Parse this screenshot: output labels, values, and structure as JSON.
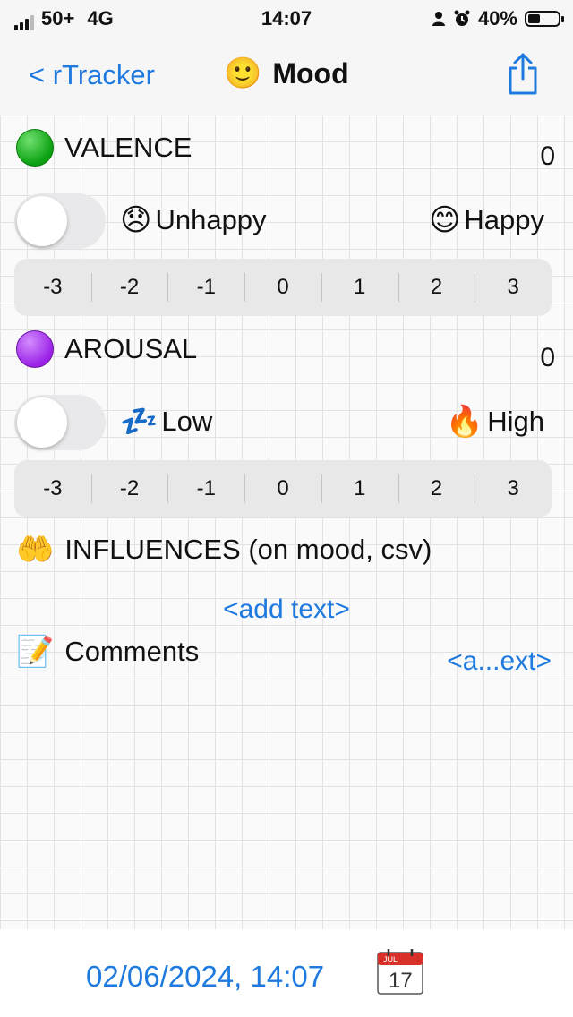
{
  "status_bar": {
    "carrier": "50+",
    "network": "4G",
    "time": "14:07",
    "battery": "40%",
    "battery_fraction": 0.4
  },
  "nav": {
    "back_label": "< rTracker",
    "title_emoji": "🙂",
    "title": "Mood"
  },
  "valence": {
    "label": "VALENCE",
    "value": "0",
    "left_emoji": "😞",
    "left_label": "Unhappy",
    "right_emoji": "😊",
    "right_label": "Happy",
    "scale": [
      "-3",
      "-2",
      "-1",
      "0",
      "1",
      "2",
      "3"
    ]
  },
  "arousal": {
    "label": "AROUSAL",
    "value": "0",
    "left_emoji": "💤",
    "left_label": "Low",
    "right_emoji": "🔥",
    "right_label": "High",
    "scale": [
      "-3",
      "-2",
      "-1",
      "0",
      "1",
      "2",
      "3"
    ]
  },
  "influences": {
    "emoji": "🤲",
    "label": "INFLUENCES (on mood, csv)",
    "add_text": "<add text>"
  },
  "comments": {
    "emoji": "📝",
    "label": "Comments",
    "link": "<a...ext>"
  },
  "footer": {
    "datetime": "02/06/2024, 14:07",
    "calendar_month": "JUL",
    "calendar_day": "17"
  },
  "colors": {
    "accent": "#1f7ae0",
    "valence_dot": "#11a811",
    "arousal_dot": "#9a22e6"
  }
}
